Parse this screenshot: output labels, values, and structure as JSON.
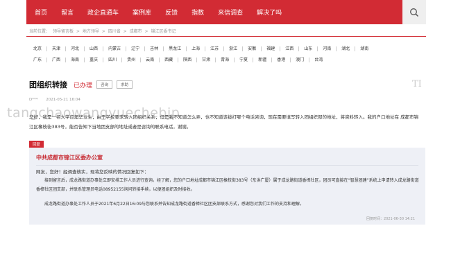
{
  "nav": {
    "items": [
      "首页",
      "留言",
      "政企直通车",
      "案例库",
      "反馈",
      "指数",
      "来信调查",
      "解决了吗"
    ]
  },
  "breadcrumb": [
    "当前位置：",
    "领导留言板",
    ">",
    "地方领导",
    ">",
    "四川省",
    ">",
    "成都市",
    ">",
    "锦江区委书记"
  ],
  "regions": {
    "row1": [
      "北京",
      "天津",
      "河北",
      "山西",
      "内蒙古",
      "辽宁",
      "吉林",
      "黑龙江",
      "上海",
      "江苏",
      "浙江",
      "安徽",
      "福建",
      "江西",
      "山东",
      "河南",
      "湖北",
      "湖南"
    ],
    "row2": [
      "广东",
      "广西",
      "海南",
      "重庆",
      "四川",
      "贵州",
      "云南",
      "西藏",
      "陕西",
      "甘肃",
      "青海",
      "宁夏",
      "新疆",
      "香港",
      "澳门",
      "台湾"
    ]
  },
  "message": {
    "title": "团组织转接",
    "status": "已办理",
    "btn_consult": "咨询",
    "btn_help": "求助",
    "author": "D***",
    "time": "2021-05-21 16:04",
    "content": "您好，我是一名大学应届毕业生，由于学校要求转入团组织关系，但是我不知道怎么弄，也不知道该拨打哪个电话咨询，现在需要填写转入团组织部的地址，将资料转入。我的户口地址在 成都市锦江区橡枝街383号，能否告知下当地团支部的地址或者是咨询的联系电话，谢谢。"
  },
  "brand_mark": "TI",
  "watermark": "tangchaowangyuechebjp",
  "reply": {
    "tag": "回复",
    "department": "中共成都市锦江区委办公室",
    "greeting": "网友，您好！经调查核实，现将您反映的情况回复如下：",
    "body1": "接到留言后，成龙路街道办事处立即安排工作人员进行查询。经了解，您的户口地址成都市锦江区橡枝街383号（东洪广厦）属于成龙路街道香樟社区，团员可直接在“智慧团建”系统上申请转入成龙路街道香樟社区团支部，并联系管理员电话08952155询问转接手续，以便团组织及时接收。",
    "body2": "成龙路街道办事处工作人员于2021年6月22日16:09与您联系并告知成龙路街道香樟社区团支部联系方式，感谢您对我们工作的支持和理解。",
    "time": "回复时间：2021-06-30 14:21"
  }
}
